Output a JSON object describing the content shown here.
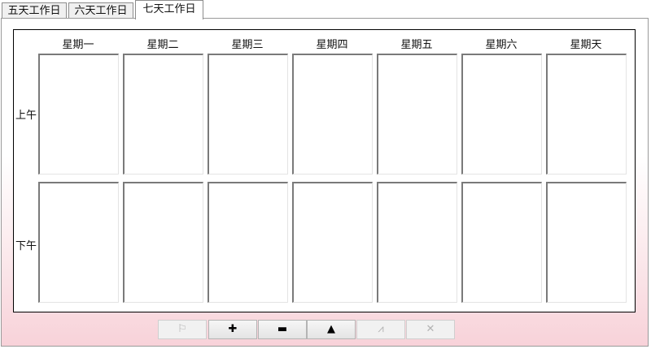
{
  "tabs": [
    {
      "label": "五天工作日",
      "active": false
    },
    {
      "label": "六天工作日",
      "active": false
    },
    {
      "label": "七天工作日",
      "active": true
    }
  ],
  "schedule": {
    "days": [
      "星期一",
      "星期二",
      "星期三",
      "星期四",
      "星期五",
      "星期六",
      "星期天"
    ],
    "periods": [
      "上午",
      "下午"
    ]
  },
  "toolbar": {
    "buttons": [
      {
        "name": "flag-button",
        "icon": "flag-icon",
        "glyph": "⚐",
        "enabled": false
      },
      {
        "name": "add-button",
        "icon": "plus-icon",
        "glyph": "✚",
        "enabled": true
      },
      {
        "name": "remove-button",
        "icon": "minus-icon",
        "glyph": "▬",
        "enabled": true
      },
      {
        "name": "up-button",
        "icon": "triangle-up-icon",
        "glyph": "▲",
        "enabled": true
      },
      {
        "name": "chart-button",
        "icon": "line-chart-icon",
        "glyph": "⩘",
        "enabled": false
      },
      {
        "name": "clear-button",
        "icon": "close-icon",
        "glyph": "✕",
        "enabled": false
      }
    ]
  },
  "colors": {
    "panel_gradient_end": "#f8d2d9",
    "cell_border": "#7a7a7a",
    "frame_border": "#000000"
  }
}
